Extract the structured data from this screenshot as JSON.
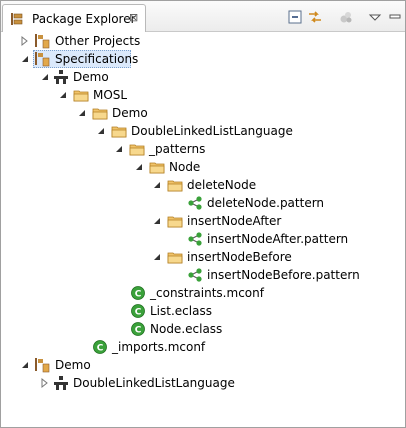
{
  "view": {
    "tab_title": "Package Explorer",
    "close_glyph": "⊠",
    "toolbar": [
      "collapse-all-icon",
      "link-with-editor-icon",
      "focus-icon",
      "view-menu-icon"
    ]
  },
  "tree": {
    "other_projects": "Other Projects",
    "specifications": "Specifications",
    "demo_project": "Demo",
    "mosl": "MOSL",
    "demo_folder": "Demo",
    "dll_folder": "DoubleLinkedListLanguage",
    "patterns": "_patterns",
    "node": "Node",
    "delete_node": "deleteNode",
    "delete_node_file": "deleteNode.pattern",
    "insert_after": "insertNodeAfter",
    "insert_after_file": "insertNodeAfter.pattern",
    "insert_before": "insertNodeBefore",
    "insert_before_file": "insertNodeBefore.pattern",
    "constraints": "_constraints.mconf",
    "list_eclass": "List.eclass",
    "node_eclass": "Node.eclass",
    "imports": "_imports.mconf",
    "demo_ws": "Demo",
    "dll_project": "DoubleLinkedListLanguage"
  }
}
